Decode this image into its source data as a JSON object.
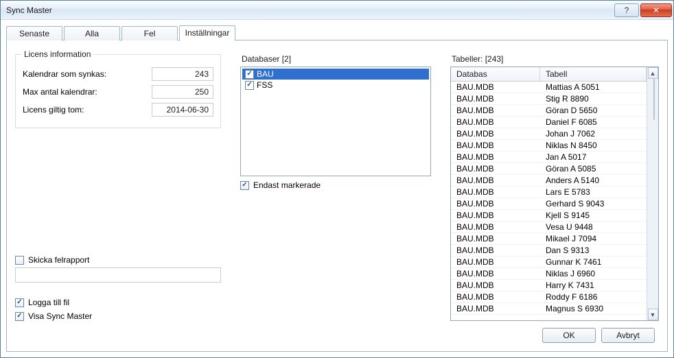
{
  "window": {
    "title": "Sync Master"
  },
  "tabs": [
    {
      "label": "Senaste"
    },
    {
      "label": "Alla"
    },
    {
      "label": "Fel"
    },
    {
      "label": "Inställningar"
    }
  ],
  "active_tab": 3,
  "license": {
    "group_title": "Licens information",
    "rows": {
      "synced_calendars": {
        "label": "Kalendrar som synkas:",
        "value": "243"
      },
      "max_calendars": {
        "label": "Max antal kalendrar:",
        "value": "250"
      },
      "valid_until": {
        "label": "Licens giltig tom:",
        "value": "2014-06-30"
      }
    }
  },
  "databases": {
    "label": "Databaser [2]",
    "items": [
      {
        "name": "BAU",
        "checked": true,
        "selected": true
      },
      {
        "name": "FSS",
        "checked": true,
        "selected": false
      }
    ],
    "only_marked_label": "Endast markerade",
    "only_marked_checked": true
  },
  "tables": {
    "label": "Tabeller: [243]",
    "headers": {
      "db": "Databas",
      "table": "Tabell"
    },
    "rows": [
      {
        "db": "BAU.MDB",
        "table": "Mattias A 5051"
      },
      {
        "db": "BAU.MDB",
        "table": "Stig R 8890"
      },
      {
        "db": "BAU.MDB",
        "table": "Göran D 5650"
      },
      {
        "db": "BAU.MDB",
        "table": "Daniel F 6085"
      },
      {
        "db": "BAU.MDB",
        "table": "Johan J 7062"
      },
      {
        "db": "BAU.MDB",
        "table": "Niklas N 8450"
      },
      {
        "db": "BAU.MDB",
        "table": "Jan A 5017"
      },
      {
        "db": "BAU.MDB",
        "table": "Göran A 5085"
      },
      {
        "db": "BAU.MDB",
        "table": "Anders A 5140"
      },
      {
        "db": "BAU.MDB",
        "table": "Lars E 5783"
      },
      {
        "db": "BAU.MDB",
        "table": "Gerhard S 9043"
      },
      {
        "db": "BAU.MDB",
        "table": "Kjell S 9145"
      },
      {
        "db": "BAU.MDB",
        "table": "Vesa U 9448"
      },
      {
        "db": "BAU.MDB",
        "table": "Mikael J 7094"
      },
      {
        "db": "BAU.MDB",
        "table": "Dan S 9313"
      },
      {
        "db": "BAU.MDB",
        "table": "Gunnar K 7461"
      },
      {
        "db": "BAU.MDB",
        "table": "Niklas J 6960"
      },
      {
        "db": "BAU.MDB",
        "table": "Harry K 7431"
      },
      {
        "db": "BAU.MDB",
        "table": "Roddy F 6186"
      },
      {
        "db": "BAU.MDB",
        "table": "Magnus S 6930"
      }
    ]
  },
  "options": {
    "send_error_report": {
      "label": "Skicka felrapport",
      "checked": false
    },
    "log_to_file": {
      "label": "Logga till fil",
      "checked": true
    },
    "show_sync_master": {
      "label": "Visa Sync Master",
      "checked": true
    }
  },
  "buttons": {
    "ok": "OK",
    "cancel": "Avbryt"
  }
}
